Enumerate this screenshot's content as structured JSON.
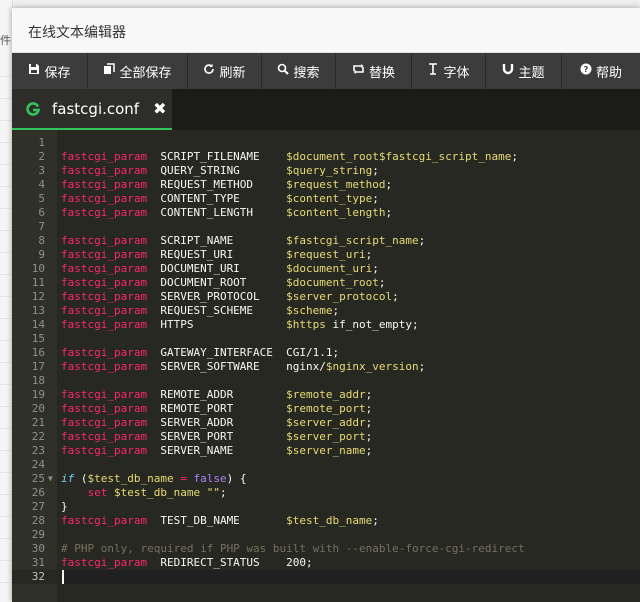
{
  "window": {
    "title": "在线文本编辑器"
  },
  "background": {
    "stub_text": "件"
  },
  "toolbar": {
    "buttons": [
      {
        "label": "保存",
        "icon": "floppy-icon"
      },
      {
        "label": "全部保存",
        "icon": "copy-icon"
      },
      {
        "label": "刷新",
        "icon": "refresh-icon"
      },
      {
        "label": "搜索",
        "icon": "search-icon"
      },
      {
        "label": "替换",
        "icon": "replace-icon"
      },
      {
        "label": "字体",
        "icon": "text-cursor-icon"
      },
      {
        "label": "主题",
        "icon": "magnet-icon"
      },
      {
        "label": "帮助",
        "icon": "help-icon"
      }
    ]
  },
  "tab": {
    "label": "fastcgi.conf",
    "icon": "g-file-icon",
    "close_glyph": "✖"
  },
  "editor": {
    "active_line": 32,
    "fold_marker_line": 25,
    "lines": [
      [],
      [
        [
          "fn",
          "fastcgi_param"
        ],
        [
          "plain",
          "  SCRIPT_FILENAME    "
        ],
        [
          "var",
          "$document_root$fastcgi_script_name"
        ],
        [
          "plain",
          ";"
        ]
      ],
      [
        [
          "fn",
          "fastcgi_param"
        ],
        [
          "plain",
          "  QUERY_STRING       "
        ],
        [
          "var",
          "$query_string"
        ],
        [
          "plain",
          ";"
        ]
      ],
      [
        [
          "fn",
          "fastcgi_param"
        ],
        [
          "plain",
          "  REQUEST_METHOD     "
        ],
        [
          "var",
          "$request_method"
        ],
        [
          "plain",
          ";"
        ]
      ],
      [
        [
          "fn",
          "fastcgi_param"
        ],
        [
          "plain",
          "  CONTENT_TYPE       "
        ],
        [
          "var",
          "$content_type"
        ],
        [
          "plain",
          ";"
        ]
      ],
      [
        [
          "fn",
          "fastcgi_param"
        ],
        [
          "plain",
          "  CONTENT_LENGTH     "
        ],
        [
          "var",
          "$content_length"
        ],
        [
          "plain",
          ";"
        ]
      ],
      [],
      [
        [
          "fn",
          "fastcgi_param"
        ],
        [
          "plain",
          "  SCRIPT_NAME        "
        ],
        [
          "var",
          "$fastcgi_script_name"
        ],
        [
          "plain",
          ";"
        ]
      ],
      [
        [
          "fn",
          "fastcgi_param"
        ],
        [
          "plain",
          "  REQUEST_URI        "
        ],
        [
          "var",
          "$request_uri"
        ],
        [
          "plain",
          ";"
        ]
      ],
      [
        [
          "fn",
          "fastcgi_param"
        ],
        [
          "plain",
          "  DOCUMENT_URI       "
        ],
        [
          "var",
          "$document_uri"
        ],
        [
          "plain",
          ";"
        ]
      ],
      [
        [
          "fn",
          "fastcgi_param"
        ],
        [
          "plain",
          "  DOCUMENT_ROOT      "
        ],
        [
          "var",
          "$document_root"
        ],
        [
          "plain",
          ";"
        ]
      ],
      [
        [
          "fn",
          "fastcgi_param"
        ],
        [
          "plain",
          "  SERVER_PROTOCOL    "
        ],
        [
          "var",
          "$server_protocol"
        ],
        [
          "plain",
          ";"
        ]
      ],
      [
        [
          "fn",
          "fastcgi_param"
        ],
        [
          "plain",
          "  REQUEST_SCHEME     "
        ],
        [
          "var",
          "$scheme"
        ],
        [
          "plain",
          ";"
        ]
      ],
      [
        [
          "fn",
          "fastcgi_param"
        ],
        [
          "plain",
          "  HTTPS              "
        ],
        [
          "var",
          "$https"
        ],
        [
          "plain",
          " if_not_empty;"
        ]
      ],
      [],
      [
        [
          "fn",
          "fastcgi_param"
        ],
        [
          "plain",
          "  GATEWAY_INTERFACE  CGI/1.1;"
        ]
      ],
      [
        [
          "fn",
          "fastcgi_param"
        ],
        [
          "plain",
          "  SERVER_SOFTWARE    nginx/"
        ],
        [
          "var",
          "$nginx_version"
        ],
        [
          "plain",
          ";"
        ]
      ],
      [],
      [
        [
          "fn",
          "fastcgi_param"
        ],
        [
          "plain",
          "  REMOTE_ADDR        "
        ],
        [
          "var",
          "$remote_addr"
        ],
        [
          "plain",
          ";"
        ]
      ],
      [
        [
          "fn",
          "fastcgi_param"
        ],
        [
          "plain",
          "  REMOTE_PORT        "
        ],
        [
          "var",
          "$remote_port"
        ],
        [
          "plain",
          ";"
        ]
      ],
      [
        [
          "fn",
          "fastcgi_param"
        ],
        [
          "plain",
          "  SERVER_ADDR        "
        ],
        [
          "var",
          "$server_addr"
        ],
        [
          "plain",
          ";"
        ]
      ],
      [
        [
          "fn",
          "fastcgi_param"
        ],
        [
          "plain",
          "  SERVER_PORT        "
        ],
        [
          "var",
          "$server_port"
        ],
        [
          "plain",
          ";"
        ]
      ],
      [
        [
          "fn",
          "fastcgi_param"
        ],
        [
          "plain",
          "  SERVER_NAME        "
        ],
        [
          "var",
          "$server_name"
        ],
        [
          "plain",
          ";"
        ]
      ],
      [],
      [
        [
          "kw",
          "if"
        ],
        [
          "plain",
          " ("
        ],
        [
          "var",
          "$test_db_name"
        ],
        [
          "plain",
          " "
        ],
        [
          "op",
          "="
        ],
        [
          "plain",
          " "
        ],
        [
          "const",
          "false"
        ],
        [
          "plain",
          ") {"
        ]
      ],
      [
        [
          "plain",
          "    "
        ],
        [
          "op",
          "set"
        ],
        [
          "plain",
          " "
        ],
        [
          "var",
          "$test_db_name"
        ],
        [
          "plain",
          " "
        ],
        [
          "str",
          "\"\""
        ],
        [
          "plain",
          ";"
        ]
      ],
      [
        [
          "plain",
          "}"
        ]
      ],
      [
        [
          "fn",
          "fastcgi_param"
        ],
        [
          "plain",
          "  TEST_DB_NAME       "
        ],
        [
          "var",
          "$test_db_name"
        ],
        [
          "plain",
          ";"
        ]
      ],
      [],
      [
        [
          "comment",
          "# PHP only, required if PHP was built with --enable-force-cgi-redirect"
        ]
      ],
      [
        [
          "fn",
          "fastcgi_param"
        ],
        [
          "plain",
          "  REDIRECT_STATUS    200;"
        ]
      ],
      []
    ]
  }
}
